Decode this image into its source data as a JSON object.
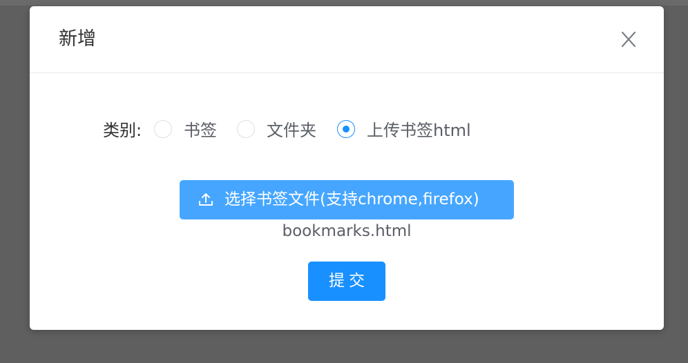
{
  "dialog": {
    "title": "新增",
    "close_icon": "close-icon"
  },
  "form": {
    "category_label": "类别:",
    "options": [
      {
        "label": "书签",
        "selected": false
      },
      {
        "label": "文件夹",
        "selected": false
      },
      {
        "label": "上传书签html",
        "selected": true
      }
    ],
    "upload_button_label": "选择书签文件(支持chrome,firefox)",
    "upload_icon": "upload-icon",
    "file_name": "bookmarks.html",
    "submit_label": "提交"
  },
  "colors": {
    "primary": "#1890ff",
    "upload_button": "#46a6ff",
    "overlay": "#5f5f5f"
  }
}
